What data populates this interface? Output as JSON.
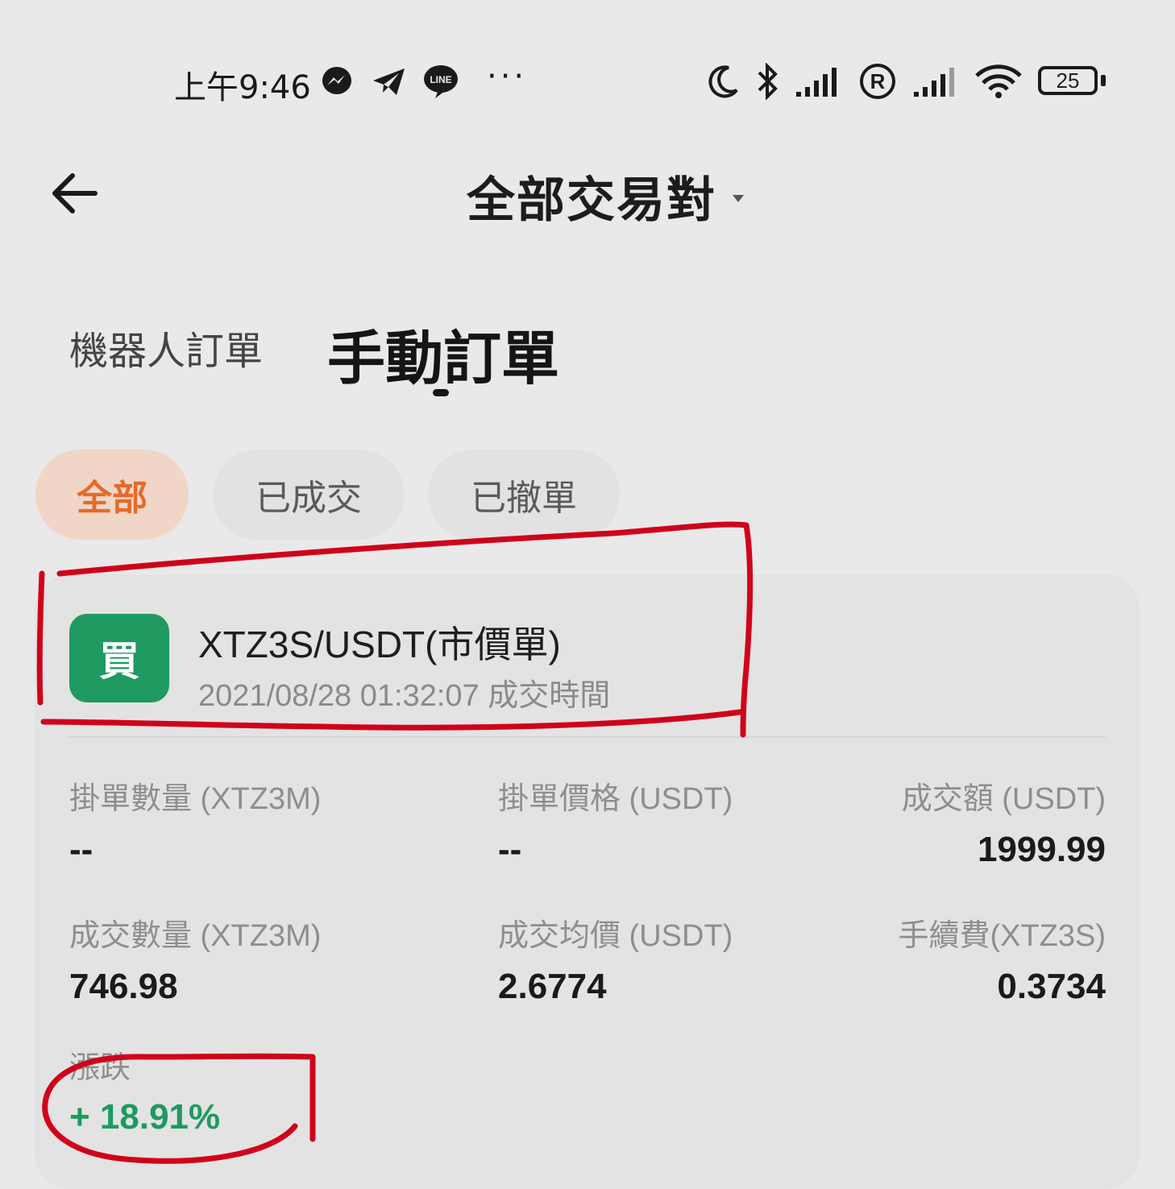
{
  "status_bar": {
    "time": "上午9:46",
    "more": "···",
    "battery": "25"
  },
  "header": {
    "title": "全部交易對"
  },
  "tabs": {
    "robot": "機器人訂單",
    "manual": "手動訂單"
  },
  "filters": {
    "all": "全部",
    "filled": "已成交",
    "canceled": "已撤單"
  },
  "order": {
    "side": "買",
    "pair": "XTZ3S/USDT(市價單)",
    "time_line": "2021/08/28 01:32:07 成交時間",
    "fields": {
      "order_qty_label": "掛單數量 (XTZ3M)",
      "order_qty_value": "--",
      "order_price_label": "掛單價格 (USDT)",
      "order_price_value": "--",
      "turnover_label": "成交額 (USDT)",
      "turnover_value": "1999.99",
      "filled_qty_label": "成交數量 (XTZ3M)",
      "filled_qty_value": "746.98",
      "avg_price_label": "成交均價 (USDT)",
      "avg_price_value": "2.6774",
      "fee_label": "手續費(XTZ3S)",
      "fee_value": "0.3734",
      "change_label": "漲跌",
      "change_value": "+ 18.91%"
    }
  },
  "colors": {
    "accent_orange": "#e46b2a",
    "buy_green": "#1e9a60",
    "annotation_red": "#d0021b"
  }
}
